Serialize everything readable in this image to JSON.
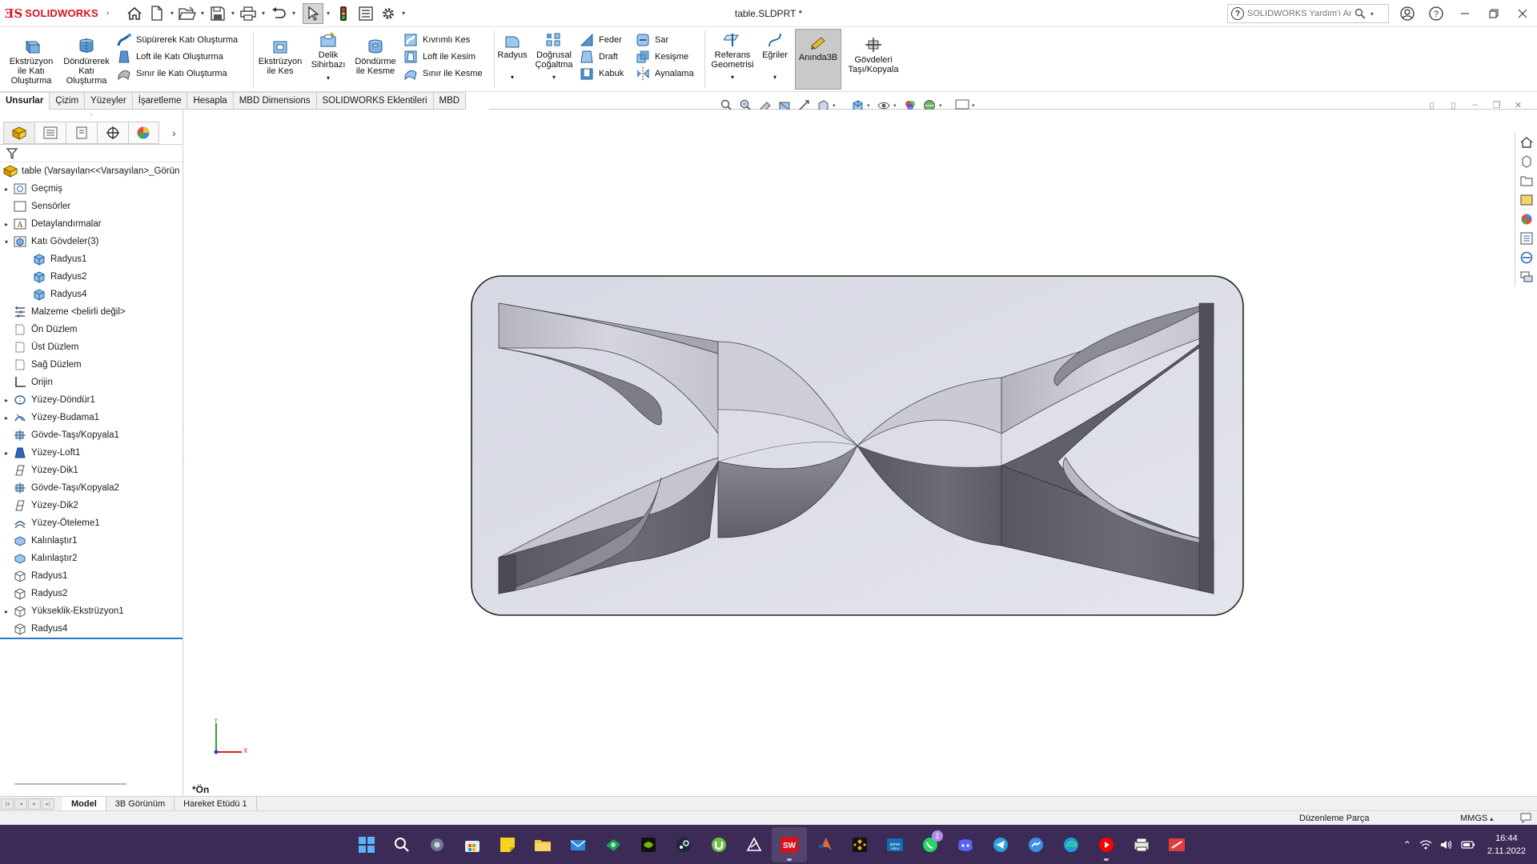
{
  "app": {
    "brand": "SOLIDWORKS",
    "document_title": "table.SLDPRT *",
    "search_placeholder": "SOLIDWORKS Yardım'ı Ara"
  },
  "ribbon": {
    "extrude_boss": "Ekstrüzyon ile Katı Oluşturma",
    "revolve_boss": "Döndürerek Katı Oluşturma",
    "swept_boss": "Süpürerek Katı Oluşturma",
    "loft_boss": "Loft ile Katı Oluşturma",
    "boundary_boss": "Sınır ile Katı Oluşturma",
    "extruded_cut": "Ekstrüzyon ile Kes",
    "hole_wizard": "Delik Sihirbazı",
    "revolved_cut": "Döndürme ile Kesme",
    "swept_cut": "Kıvrımlı Kes",
    "lofted_cut": "Loft ile Kesim",
    "boundary_cut": "Sınır ile Kesme",
    "fillet": "Radyus",
    "linear_pattern": "Doğrusal Çoğaltma",
    "rib": "Feder",
    "draft": "Draft",
    "shell": "Kabuk",
    "wrap": "Sar",
    "intersect": "Kesişme",
    "mirror": "Aynalama",
    "reference_geometry": "Referans Geometrisi",
    "curves": "Eğriler",
    "instant3d": "Anında3B",
    "move_copy_bodies": "Gövdeleri Taşı/Kopyala"
  },
  "command_tabs": [
    "Unsurlar",
    "Çizim",
    "Yüzeyler",
    "İşaretleme",
    "Hesapla",
    "MBD Dimensions",
    "SOLIDWORKS Eklentileri",
    "MBD"
  ],
  "tree": {
    "root": "table  (Varsayılan<<Varsayılan>_Görün",
    "items": [
      {
        "label": "Geçmiş",
        "expandable": true,
        "icon": "history-icon"
      },
      {
        "label": "Sensörler",
        "expandable": false,
        "icon": "sensor-icon"
      },
      {
        "label": "Detaylandırmalar",
        "expandable": true,
        "icon": "annotation-icon"
      },
      {
        "label": "Katı Gövdeler(3)",
        "expandable": true,
        "expanded": true,
        "icon": "solid-bodies-icon"
      },
      {
        "label": "Radyus1",
        "child": true,
        "icon": "solid-body-icon"
      },
      {
        "label": "Radyus2",
        "child": true,
        "icon": "solid-body-icon"
      },
      {
        "label": "Radyus4",
        "child": true,
        "icon": "solid-body-icon"
      },
      {
        "label": "Malzeme <belirli değil>",
        "expandable": false,
        "icon": "material-icon"
      },
      {
        "label": "Ön Düzlem",
        "expandable": false,
        "icon": "plane-icon"
      },
      {
        "label": "Üst Düzlem",
        "expandable": false,
        "icon": "plane-icon"
      },
      {
        "label": "Sağ Düzlem",
        "expandable": false,
        "icon": "plane-icon"
      },
      {
        "label": "Orijin",
        "expandable": false,
        "icon": "origin-icon"
      },
      {
        "label": "Yüzey-Döndür1",
        "expandable": true,
        "icon": "surface-revolve-icon"
      },
      {
        "label": "Yüzey-Budama1",
        "expandable": true,
        "icon": "surface-trim-icon"
      },
      {
        "label": "Gövde-Taşı/Kopyala1",
        "expandable": false,
        "icon": "move-body-icon"
      },
      {
        "label": "Yüzey-Loft1",
        "expandable": true,
        "icon": "surface-loft-icon"
      },
      {
        "label": "Yüzey-Dik1",
        "expandable": false,
        "icon": "ruled-surface-icon"
      },
      {
        "label": "Gövde-Taşı/Kopyala2",
        "expandable": false,
        "icon": "move-body-icon"
      },
      {
        "label": "Yüzey-Dik2",
        "expandable": false,
        "icon": "ruled-surface-icon"
      },
      {
        "label": "Yüzey-Öteleme1",
        "expandable": false,
        "icon": "offset-surface-icon"
      },
      {
        "label": "Kalınlaştır1",
        "expandable": false,
        "icon": "thicken-icon"
      },
      {
        "label": "Kalınlaştır2",
        "expandable": false,
        "icon": "thicken-icon"
      },
      {
        "label": "Radyus1",
        "expandable": false,
        "icon": "fillet-icon"
      },
      {
        "label": "Radyus2",
        "expandable": false,
        "icon": "fillet-icon"
      },
      {
        "label": "Yükseklik-Ekstrüzyon1",
        "expandable": true,
        "icon": "extrude-icon"
      },
      {
        "label": "Radyus4",
        "expandable": false,
        "icon": "fillet-icon"
      }
    ]
  },
  "viewport": {
    "view_name": "*Ön",
    "triad_x": "X",
    "triad_y": "Y"
  },
  "bottom_tabs": [
    "Model",
    "3B Görünüm",
    "Hareket Etüdü 1"
  ],
  "status": {
    "mode": "Düzenleme Parça",
    "units": "MMGS"
  },
  "taskbar": {
    "time": "16:44",
    "date": "2.11.2022",
    "whatsapp_badge": "1"
  },
  "colors": {
    "brand_red": "#d6121f",
    "taskbar_bg": "#3b2b56",
    "model_face_light": "#c9cad3",
    "model_face_dark": "#60616b",
    "selection_blue": "#2b78c5"
  }
}
